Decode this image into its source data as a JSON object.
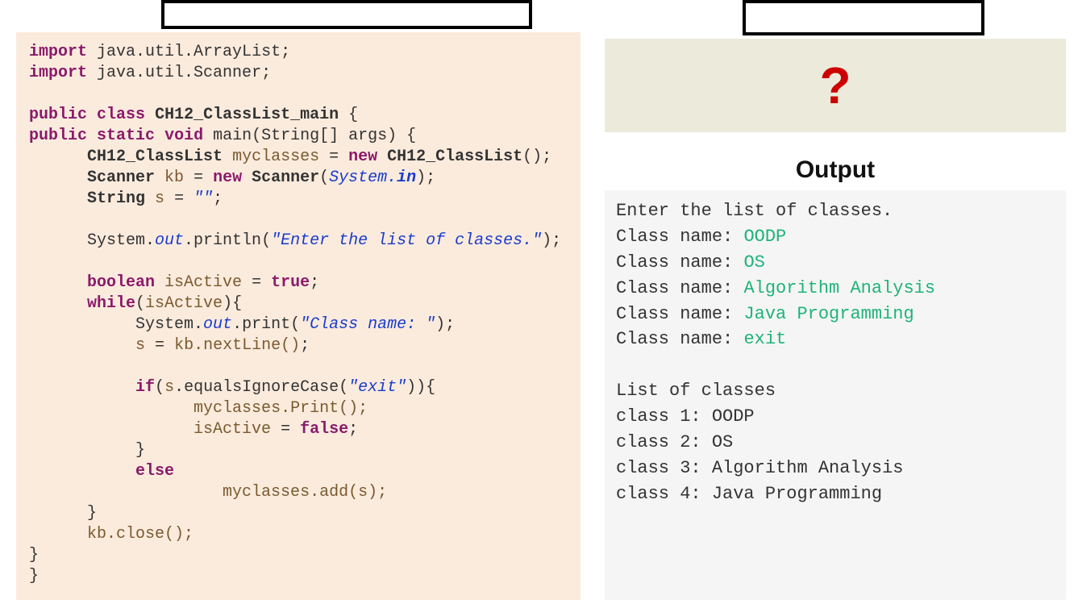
{
  "left": {
    "label_text": "",
    "code": {
      "imports": [
        "java.util.ArrayList",
        "java.util.Scanner"
      ],
      "class_decl": "CH12_ClassList_main",
      "main_sig": "main(String[] args)",
      "list_type": "CH12_ClassList",
      "list_var": "myclasses",
      "scanner_var": "kb",
      "scanner_src": "System.in",
      "str_var": "s",
      "str_init": "\"\"",
      "println_arg": "\"Enter the list of classes.\"",
      "active_var": "isActive",
      "print_arg": "\"Class name: \"",
      "nextline_call": "kb.nextLine()",
      "exit_literal": "\"exit\"",
      "print_call": "myclasses.Print();",
      "add_call": "myclasses.add(s);",
      "close_call": "kb.close();"
    }
  },
  "right": {
    "label_text": "",
    "question": "?",
    "output_title": "Output",
    "output": {
      "prompt_line": "Enter the list of classes.",
      "prompt_label": "Class name: ",
      "inputs": [
        "OODP",
        "OS",
        "Algorithm Analysis",
        "Java Programming",
        "exit"
      ],
      "list_header": "List of classes",
      "list": [
        {
          "label": "class 1: ",
          "value": "OODP"
        },
        {
          "label": "class 2: ",
          "value": "OS"
        },
        {
          "label": "class 3: ",
          "value": "Algorithm Analysis"
        },
        {
          "label": "class 4: ",
          "value": "Java Programming"
        }
      ]
    }
  }
}
